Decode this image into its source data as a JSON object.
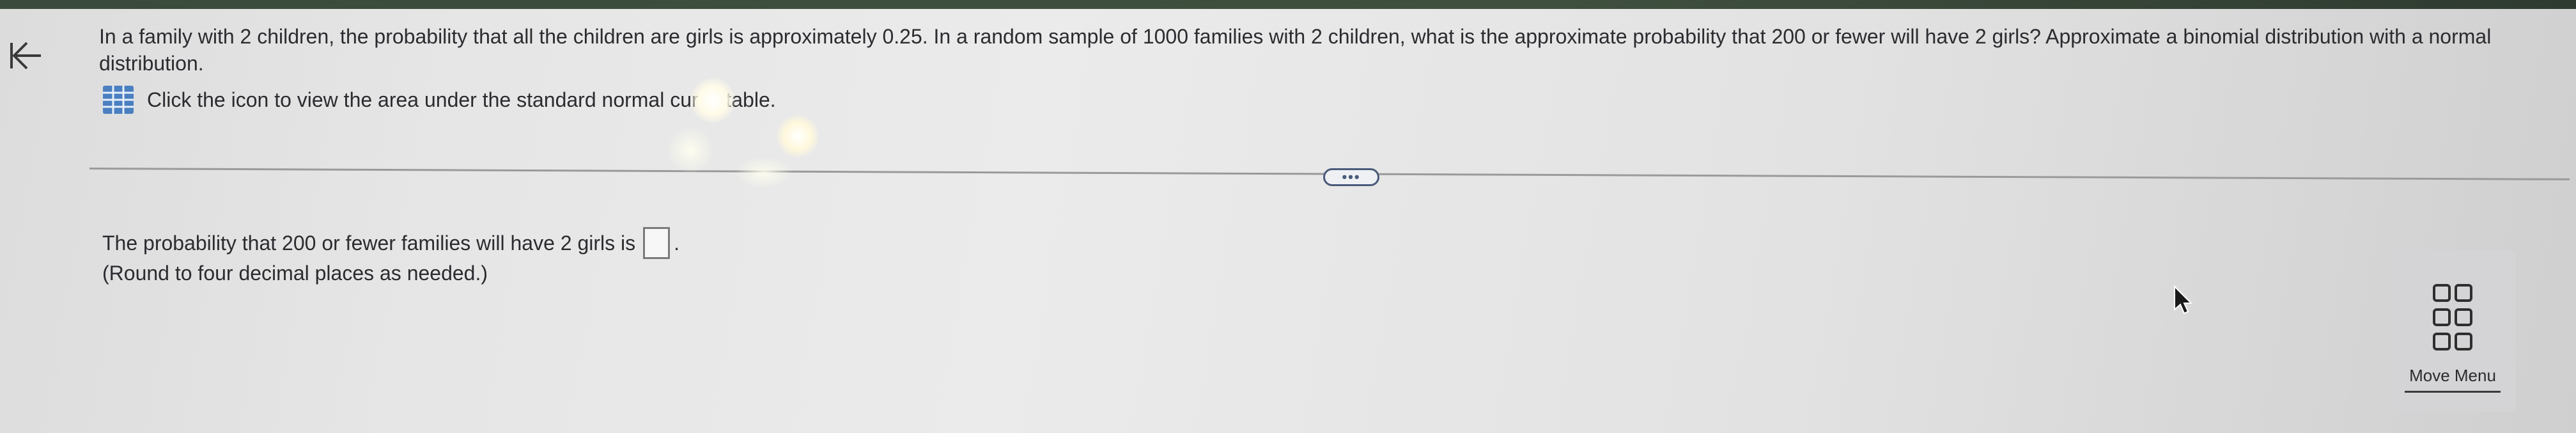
{
  "question": {
    "text": "In a family with 2 children, the probability that all the children are girls is approximately 0.25. In a random sample of 1000 families with 2 children, what is the approximate probability that 200 or fewer will have 2 girls? Approximate a binomial distribution with a normal distribution."
  },
  "hint": {
    "text": "Click the icon to view the area under the standard normal curve table.",
    "icon": "table-icon"
  },
  "more_button": {
    "label": "•••"
  },
  "answer": {
    "prefix": "The probability that 200 or fewer families will have 2 girls is",
    "suffix": ".",
    "value": "",
    "note": "(Round to four decimal places as needed.)"
  },
  "move_menu": {
    "label": "Move Menu",
    "icon": "grid-icon"
  },
  "navigation": {
    "back_icon": "back-arrow-icon"
  },
  "colors": {
    "top_strip": "#3a4a3c",
    "accent": "#4a5a7a",
    "text": "#2b2b30"
  }
}
